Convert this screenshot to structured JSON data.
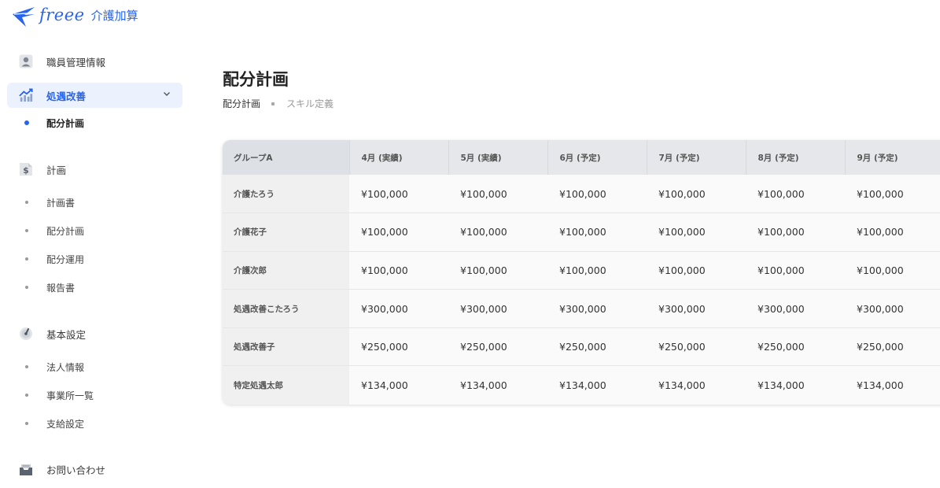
{
  "brand": {
    "wordmark": "freee",
    "product": "介護加算",
    "accent": "#2864f0"
  },
  "sidebar": {
    "items": [
      {
        "label": "職員管理情報",
        "icon": "user-icon"
      },
      {
        "label": "処遇改善",
        "icon": "chart-up-icon",
        "active": true,
        "children": [
          {
            "label": "配分計画",
            "current": true
          }
        ]
      },
      {
        "label": "計画",
        "icon": "dollar-document-icon",
        "children": [
          {
            "label": "計画書"
          },
          {
            "label": "配分計画"
          },
          {
            "label": "配分運用"
          },
          {
            "label": "報告書"
          }
        ]
      },
      {
        "label": "基本設定",
        "icon": "gauge-icon",
        "children": [
          {
            "label": "法人情報"
          },
          {
            "label": "事業所一覧"
          },
          {
            "label": "支給設定"
          }
        ]
      },
      {
        "label": "お問い合わせ",
        "icon": "inbox-icon"
      }
    ]
  },
  "main": {
    "title": "配分計画",
    "breadcrumb": {
      "current": "配分計画",
      "link": "スキル定義"
    },
    "table": {
      "headers": [
        "グループA",
        "4月 (実績)",
        "5月 (実績)",
        "6月 (予定)",
        "7月 (予定)",
        "8月 (予定)",
        "9月 (予定)"
      ],
      "rows": [
        {
          "name": "介護たろう",
          "values": [
            "¥100,000",
            "¥100,000",
            "¥100,000",
            "¥100,000",
            "¥100,000",
            "¥100,000"
          ]
        },
        {
          "name": "介護花子",
          "values": [
            "¥100,000",
            "¥100,000",
            "¥100,000",
            "¥100,000",
            "¥100,000",
            "¥100,000"
          ]
        },
        {
          "name": "介護次郎",
          "values": [
            "¥100,000",
            "¥100,000",
            "¥100,000",
            "¥100,000",
            "¥100,000",
            "¥100,000"
          ]
        },
        {
          "name": "処遇改善こたろう",
          "values": [
            "¥300,000",
            "¥300,000",
            "¥300,000",
            "¥300,000",
            "¥300,000",
            "¥300,000"
          ]
        },
        {
          "name": "処遇改善子",
          "values": [
            "¥250,000",
            "¥250,000",
            "¥250,000",
            "¥250,000",
            "¥250,000",
            "¥250,000"
          ]
        },
        {
          "name": "特定処遇太郎",
          "values": [
            "¥134,000",
            "¥134,000",
            "¥134,000",
            "¥134,000",
            "¥134,000",
            "¥134,000"
          ]
        }
      ]
    }
  }
}
